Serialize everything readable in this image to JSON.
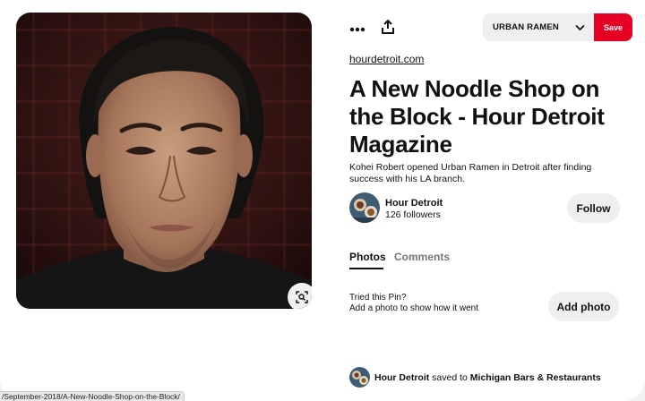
{
  "toolbar": {
    "more_icon": "ellipsis-icon",
    "share_icon": "share-upload-icon",
    "board_name": "URBAN RAMEN",
    "board_chevron_icon": "chevron-down-icon",
    "save_label": "Save",
    "save_color": "#e60023"
  },
  "pin": {
    "source": "hourdetroit.com",
    "title": "A New Noodle Shop on the Block - Hour Detroit Magazine",
    "description": "Kohei Robert opened Urban Ramen in Detroit after finding success with his LA branch.",
    "visual_search_icon": "visual-search-icon"
  },
  "creator": {
    "name": "Hour Detroit",
    "followers": "126 followers",
    "follow_label": "Follow"
  },
  "tabs": [
    {
      "label": "Photos",
      "active": true
    },
    {
      "label": "Comments",
      "active": false
    }
  ],
  "tried": {
    "title": "Tried this Pin?",
    "subtitle": "Add a photo to show how it went",
    "button_label": "Add photo"
  },
  "saved": {
    "user": "Hour Detroit",
    "verb": "saved to",
    "board": "Michigan Bars & Restaurants"
  },
  "status_bar": {
    "url": "/September-2018/A-New-Noodle-Shop-on-the-Block/"
  }
}
